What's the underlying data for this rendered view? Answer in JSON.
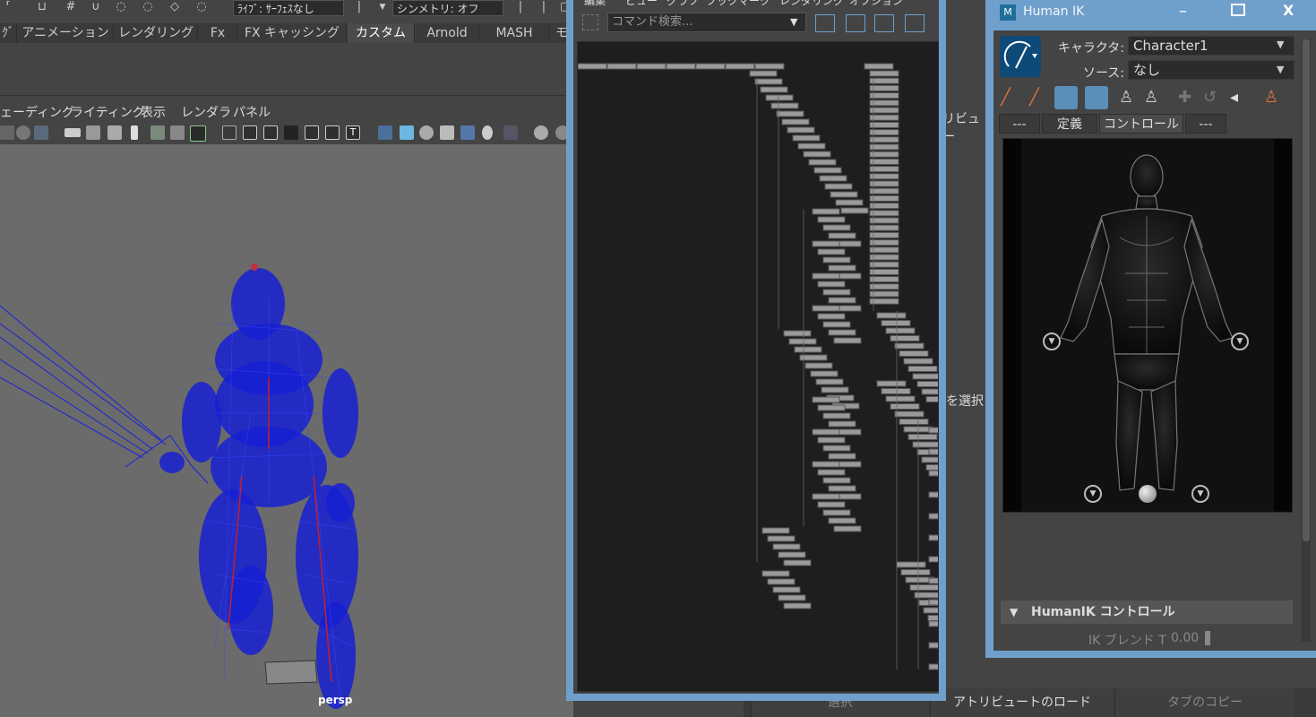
{
  "topbar": {
    "live_surface": "ﾗｲﾌﾞ: ｻｰﾌｪｽなし",
    "symmetry": "シンメトリ: オフ"
  },
  "shelf": {
    "tabs": [
      "ｸﾞ",
      "アニメーション",
      "レンダリング",
      "Fx",
      "FX キャッシング",
      "カスタム",
      "Arnold",
      "MASH",
      "モ"
    ],
    "active": "カスタム"
  },
  "panel_menu": [
    "ェーディング",
    "ライティング",
    "表示",
    "レンダラ",
    "パネル"
  ],
  "viewport": {
    "camera_label": "persp"
  },
  "node_editor": {
    "menu": [
      "編集",
      "ビュー",
      "グラフ",
      "ブックマーク",
      "レンダリング",
      "オプション"
    ],
    "search_placeholder": "コマンド検索..."
  },
  "background_panel": {
    "attribute_text": "リビュー",
    "select_text": "を選択"
  },
  "bottom_bar": {
    "select": "選択",
    "load_attributes": "アトリビュートのロード",
    "copy_tab": "タブのコピー"
  },
  "human_ik": {
    "title": "Human IK",
    "character_label": "キャラクタ:",
    "character_value": "Character1",
    "source_label": "ソース:",
    "source_value": "なし",
    "tabs": [
      "---",
      "定義",
      "コントロール",
      "---"
    ],
    "active_tab": "コントロール",
    "section_title": "HumanIK コントロール",
    "ik_blend_label": "IK ブレンド T",
    "ik_blend_value": "0.00"
  },
  "colors": {
    "window_frame": "#6fa0cc",
    "panel_bg": "#444444",
    "viewport_bg": "#6b6b6b",
    "graph_bg": "#1e1e1e",
    "wireframe": "#1a22d8"
  }
}
